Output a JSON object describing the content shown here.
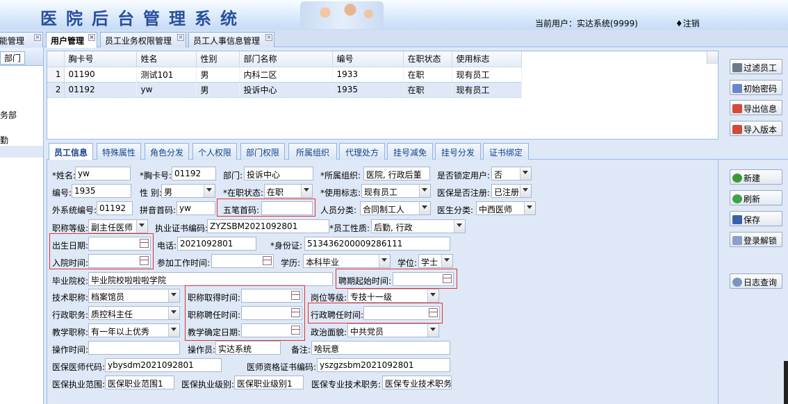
{
  "header": {
    "title": "医院后台管理系统",
    "current_user": "当前用户：实达系统(9999)",
    "logout": "♦注销"
  },
  "page_tabs": [
    {
      "label": "能管理"
    },
    {
      "label": "用户管理"
    },
    {
      "label": "员工业务权限管理"
    },
    {
      "label": "员工人事信息管理"
    }
  ],
  "left_panel": {
    "header": "部门",
    "items": [
      "务部",
      "勤"
    ]
  },
  "grid": {
    "columns": [
      "胸卡号",
      "姓名",
      "性别",
      "部门名称",
      "编号",
      "在职状态",
      "使用标志"
    ],
    "rows": [
      {
        "n": "1",
        "cells": [
          "01190",
          "测试101",
          "男",
          "内科二区",
          "1933",
          "在职",
          "现有员工"
        ]
      },
      {
        "n": "2",
        "cells": [
          "01192",
          "yw",
          "男",
          "投诉中心",
          "1935",
          "在职",
          "现有员工"
        ]
      }
    ]
  },
  "right_buttons": {
    "filter": "过滤员工",
    "init_pwd": "初始密码",
    "export": "导出信息",
    "import": "导入版本"
  },
  "sub_tabs": [
    "员工信息",
    "特殊属性",
    "角色分发",
    "个人权限",
    "部门权限",
    "所属组织",
    "代理处方",
    "挂号减免",
    "挂号分发",
    "证书绑定"
  ],
  "form": {
    "name_l": "*姓名:",
    "name_v": "yw",
    "card_l": "*胸卡号:",
    "card_v": "01192",
    "dept_l": "部门:",
    "dept_v": "投诉中心",
    "org_l": "*所属组织:",
    "org_v": "医院, 行政后董",
    "lock_l": "是否锁定用户:",
    "lock_v": "否",
    "no_l": "编号:",
    "no_v": "1935",
    "sex_l": "性 别:",
    "sex_v": "男",
    "state_l": "*在职状态:",
    "state_v": "在职",
    "flag_l": "*使用标志:",
    "flag_v": "现有员工",
    "ins_l": "医保是否注册:",
    "ins_v": "已注册",
    "ext_l": "外系统编号:",
    "ext_v": "01192",
    "py_l": "拼音首码:",
    "py_v": "yw",
    "wb_l": "五笔首码:",
    "wb_v": "",
    "pc_l": "人员分类:",
    "pc_v": "合同制工人",
    "dc_l": "医生分类:",
    "dc_v": "中西医师",
    "title_l": "职称等级:",
    "title_v": "副主任医师",
    "lic_l": "执业证书编码:",
    "lic_v": "ZYZSBM2021092801",
    "nature_l": "*员工性质:",
    "nature_v": "后勤, 行政",
    "birth_l": "出生日期:",
    "birth_v": "",
    "tel_l": "电话:",
    "tel_v": "2021092801",
    "id_l": "*身份证:",
    "id_v": "513436200009286111",
    "entry_l": "入院时间:",
    "entry_v": "",
    "work_l": "参加工作时间:",
    "work_v": "",
    "edu_l": "学历:",
    "edu_v": "本科毕业",
    "deg_l": "学位:",
    "deg_v": "学士",
    "school_l": "毕业院校:",
    "school_v": "毕业院校啦啦啦学院",
    "hire_l": "聘期起始时间:",
    "hire_v": "",
    "tech_l": "技术职称:",
    "tech_v": "档案馆员",
    "tget_l": "职称取得时间:",
    "tget_v": "",
    "pos_l": "岗位等级:",
    "pos_v": "专技十一级",
    "adm_l": "行政职务:",
    "adm_v": "质控科主任",
    "thire_l": "职称聘任时间:",
    "thire_v": "",
    "ahire_l": "行政聘任时间:",
    "ahire_v": "",
    "teach_l": "教学职称:",
    "teach_v": "有一年以上优秀",
    "tdate_l": "教学确定日期:",
    "tdate_v": "",
    "pol_l": "政治面貌:",
    "pol_v": "中共党员",
    "op_time_l": "操作时间:",
    "op_time_v": "",
    "oper_l": "操作员:",
    "oper_v": "实达系统",
    "memo_l": "备注:",
    "memo_v": "啥玩意",
    "ydoc_l": "医保医师代码:",
    "ydoc_v": "ybysdm2021092801",
    "qual_l": "医师资格证书编码:",
    "qual_v": "yszgzsbm2021092801",
    "yscope_l": "医保执业范围:",
    "yscope_v": "医保职业范围1",
    "ylevel_l": "医保执业级别:",
    "ylevel_v": "医保职业级别1",
    "ytech_l": "医保专业技术职务:",
    "ytech_v": "医保专业技术职务"
  },
  "form_buttons": {
    "new": "新建",
    "refresh": "刷新",
    "save": "保存",
    "unlock": "登录解锁",
    "log": "日志查询"
  }
}
